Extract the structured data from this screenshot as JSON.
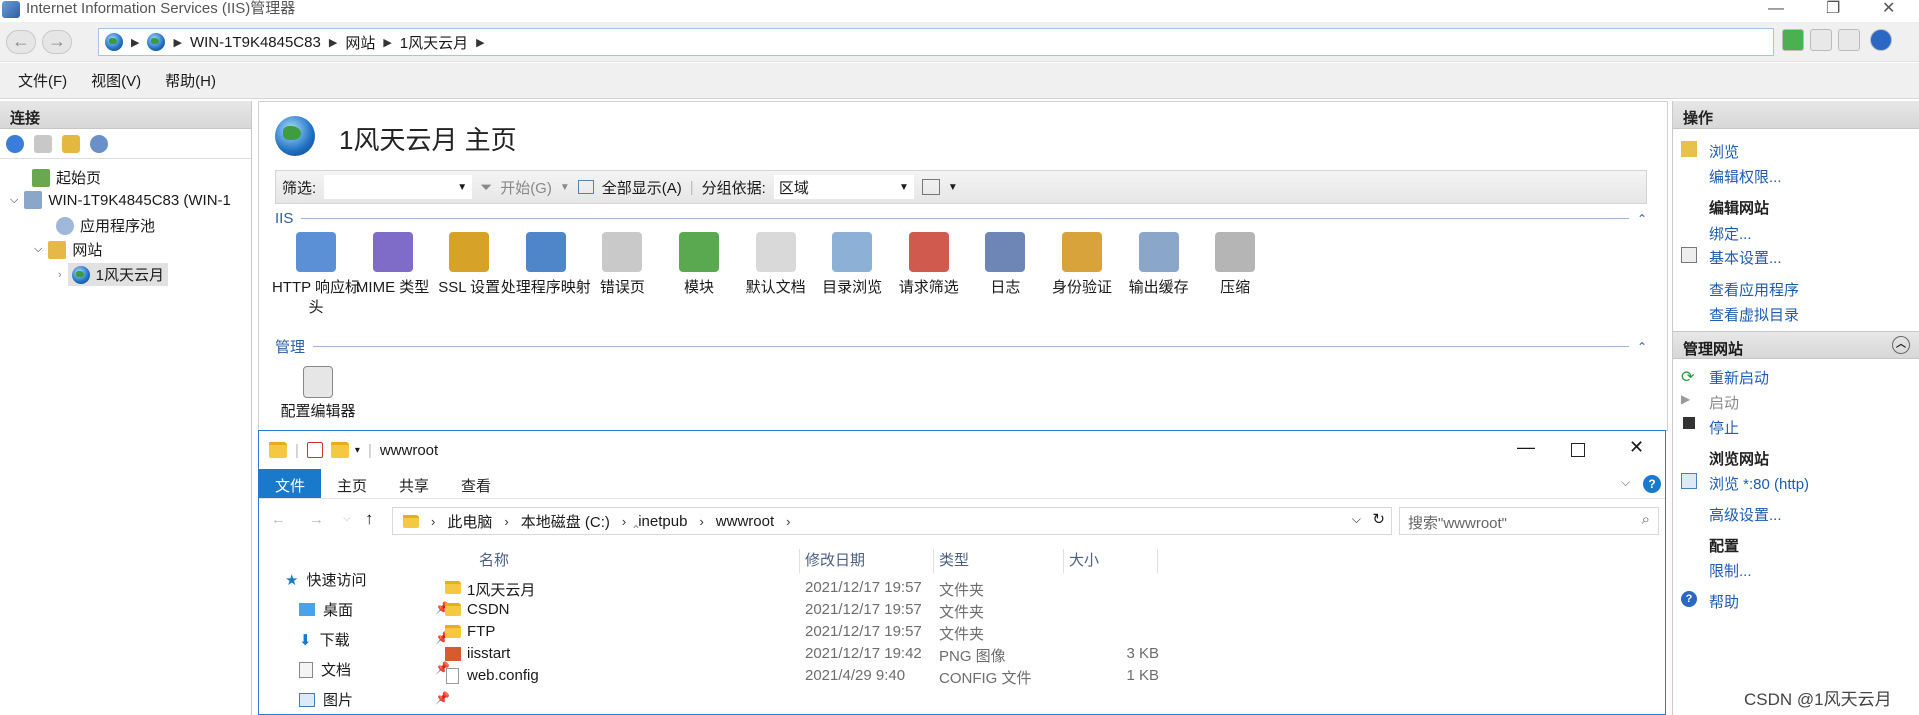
{
  "window": {
    "title": "Internet Information Services (IIS)管理器"
  },
  "address": {
    "segments": [
      "WIN-1T9K4845C83",
      "网站",
      "1风天云月"
    ]
  },
  "menu": [
    "文件(F)",
    "视图(V)",
    "帮助(H)"
  ],
  "connections": {
    "header": "连接",
    "tree": [
      {
        "label": "起始页"
      },
      {
        "label": "WIN-1T9K4845C83 (WIN-1"
      },
      {
        "label": "应用程序池"
      },
      {
        "label": "网站"
      },
      {
        "label": "1风天云月"
      }
    ]
  },
  "center": {
    "title": "1风天云月 主页",
    "filter": {
      "label": "筛选:",
      "start": "开始(G)",
      "show_all": "全部显示(A)",
      "group_label": "分组依据:",
      "group_value": "区域"
    },
    "iis_section": "IIS",
    "features": [
      "HTTP 响应标头",
      "MIME 类型",
      "SSL 设置",
      "处理程序映射",
      "错误页",
      "模块",
      "默认文档",
      "目录浏览",
      "请求筛选",
      "日志",
      "身份验证",
      "输出缓存",
      "压缩"
    ],
    "manage_section": "管理",
    "manage_items": [
      "配置编辑器"
    ]
  },
  "actions": {
    "header": "操作",
    "browse": "浏览",
    "edit_perm": "编辑权限...",
    "edit_site": "编辑网站",
    "bind": "绑定...",
    "basic": "基本设置...",
    "view_app": "查看应用程序",
    "view_vdir": "查看虚拟目录",
    "manage_site": "管理网站",
    "restart": "重新启动",
    "start": "启动",
    "stop": "停止",
    "browse_site": "浏览网站",
    "browse_http": "浏览 *:80 (http)",
    "advanced": "高级设置...",
    "config": "配置",
    "limit": "限制...",
    "help": "帮助"
  },
  "explorer": {
    "title": "wwwroot",
    "tabs": [
      "文件",
      "主页",
      "共享",
      "查看"
    ],
    "path": [
      "此电脑",
      "本地磁盘 (C:)",
      "inetpub",
      "wwwroot"
    ],
    "search_placeholder": "搜索\"wwwroot\"",
    "quick": [
      {
        "label": "快速访问"
      },
      {
        "label": "桌面"
      },
      {
        "label": "下载"
      },
      {
        "label": "文档"
      },
      {
        "label": "图片"
      }
    ],
    "columns": [
      "名称",
      "修改日期",
      "类型",
      "大小"
    ],
    "rows": [
      {
        "name": "1风天云月",
        "date": "2021/12/17 19:57",
        "type": "文件夹",
        "size": ""
      },
      {
        "name": "CSDN",
        "date": "2021/12/17 19:57",
        "type": "文件夹",
        "size": ""
      },
      {
        "name": "FTP",
        "date": "2021/12/17 19:57",
        "type": "文件夹",
        "size": ""
      },
      {
        "name": "iisstart",
        "date": "2021/12/17 19:42",
        "type": "PNG 图像",
        "size": "3 KB"
      },
      {
        "name": "web.config",
        "date": "2021/4/29 9:40",
        "type": "CONFIG 文件",
        "size": "1 KB"
      }
    ]
  },
  "watermark": "CSDN @1风天云月",
  "colors": {
    "accent": "#1979ca",
    "link": "#1e5cb3"
  }
}
